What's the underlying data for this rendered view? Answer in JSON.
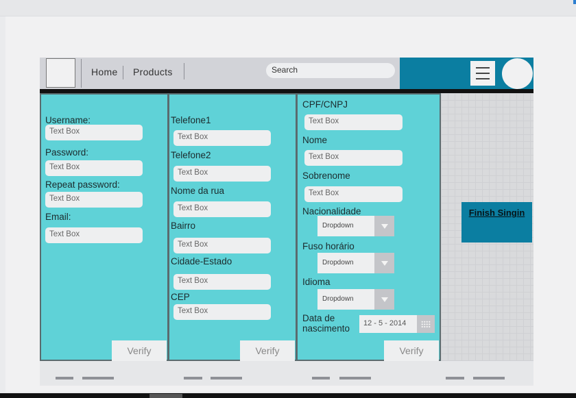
{
  "header": {
    "nav": [
      "Home",
      "Products"
    ],
    "search_placeholder": "Search"
  },
  "col1": {
    "fields": [
      {
        "label": "Username:",
        "placeholder": "Text Box"
      },
      {
        "label": "Password:",
        "placeholder": "Text Box"
      },
      {
        "label": "Repeat password:",
        "placeholder": "Text Box"
      },
      {
        "label": "Email:",
        "placeholder": "Text Box"
      }
    ],
    "verify": "Verify"
  },
  "col2": {
    "fields": [
      {
        "label": "Telefone1",
        "placeholder": "Text Box"
      },
      {
        "label": "Telefone2",
        "placeholder": "Text Box"
      },
      {
        "label": "Nome da rua",
        "placeholder": "Text Box"
      },
      {
        "label": "Bairro",
        "placeholder": "Text Box"
      },
      {
        "label": "Cidade-Estado",
        "placeholder": "Text Box"
      },
      {
        "label": "CEP",
        "placeholder": "Text Box"
      }
    ],
    "verify": "Verify"
  },
  "col3": {
    "fields": [
      {
        "label": "CPF/CNPJ",
        "placeholder": "Text Box"
      },
      {
        "label": "Nome",
        "placeholder": "Text Box"
      },
      {
        "label": "Sobrenome",
        "placeholder": "Text Box"
      }
    ],
    "dropdowns": [
      {
        "label": "Nacionalidade",
        "value": "Dropdown"
      },
      {
        "label": "Fuso horário",
        "value": "Dropdown"
      },
      {
        "label": "Idioma",
        "value": "Dropdown"
      }
    ],
    "birth_label": "Data de nascimento",
    "birth_value": "12 - 5 - 2014",
    "verify": "Verify"
  },
  "finish_label": "Finish Singin",
  "colors": {
    "panel": "#5fd2d7",
    "accent_blue": "#0b7ea1",
    "header_gray": "#d2d3d8"
  },
  "icons": [
    "hamburger-icon",
    "chevron-down-icon",
    "calendar-icon"
  ]
}
